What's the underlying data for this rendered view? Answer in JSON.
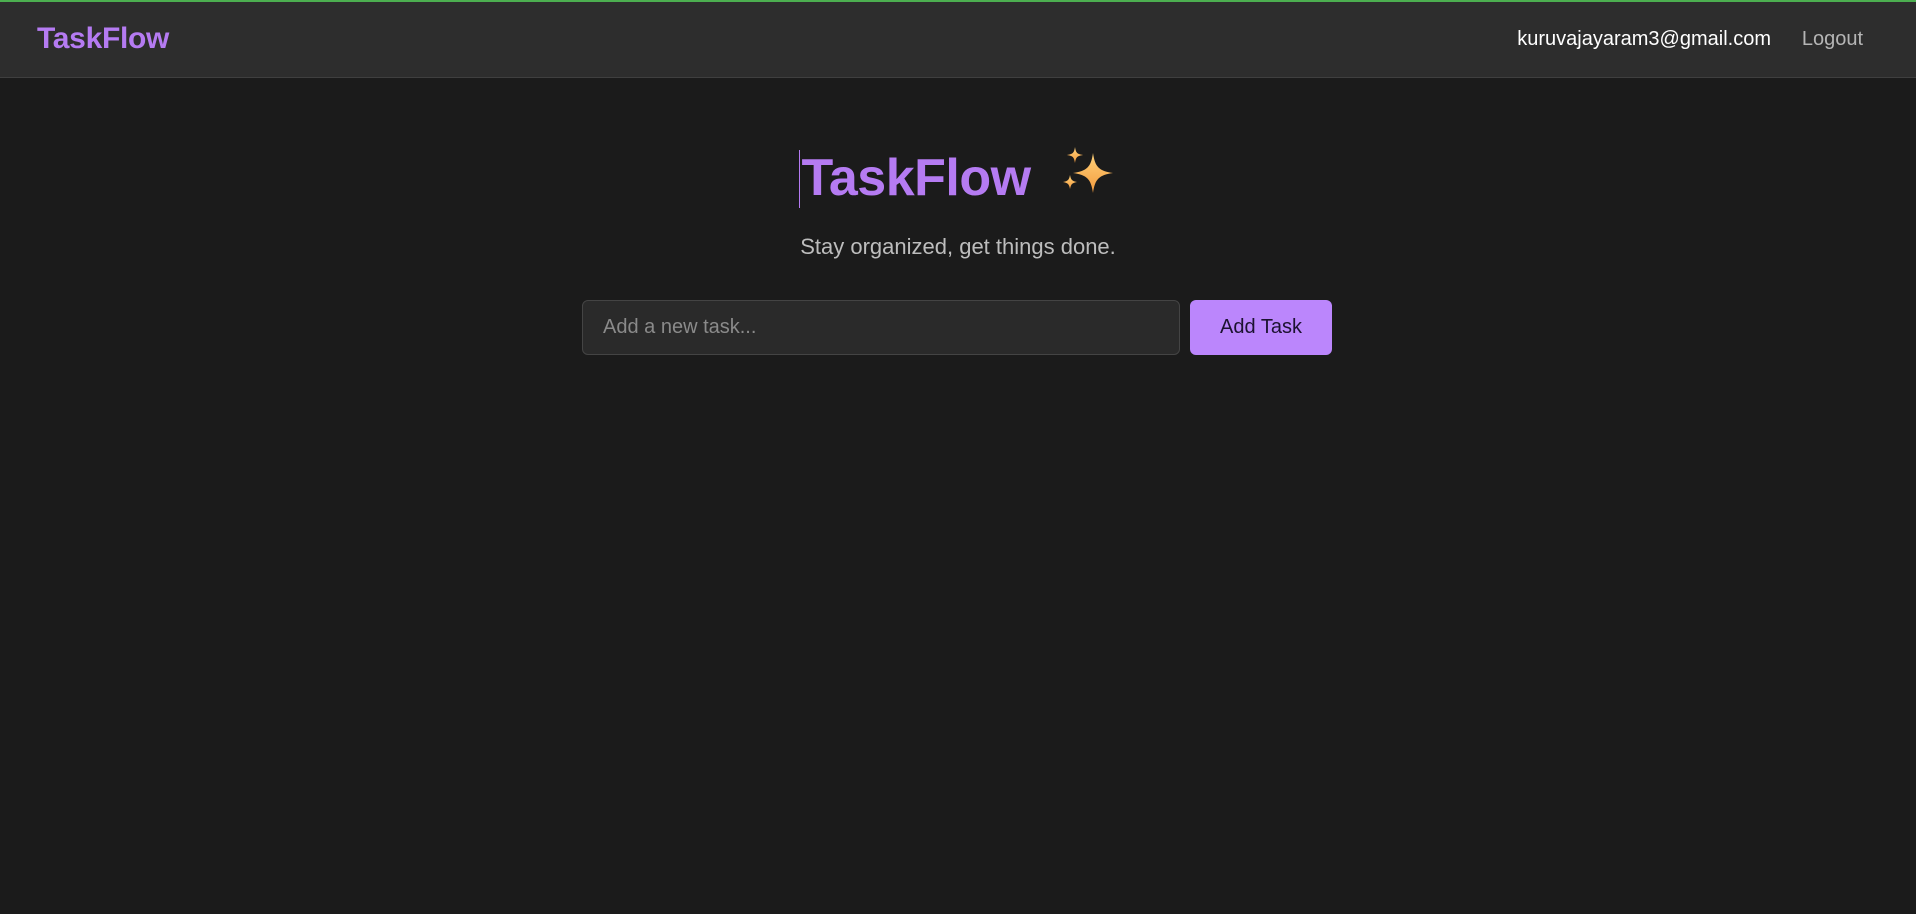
{
  "navbar": {
    "brand": "TaskFlow",
    "user_email": "kuruvajayaram3@gmail.com",
    "logout_label": "Logout"
  },
  "hero": {
    "title": "TaskFlow",
    "title_icon": "sparkles-icon",
    "subtitle": "Stay organized, get things done."
  },
  "task_form": {
    "input_value": "",
    "input_placeholder": "Add a new task...",
    "add_button_label": "Add Task"
  },
  "colors": {
    "accent": "#bb86fc",
    "brand_text": "#b57bf2",
    "background": "#1b1b1b",
    "navbar_background": "#2d2d2d",
    "top_accent": "#4caf50"
  }
}
